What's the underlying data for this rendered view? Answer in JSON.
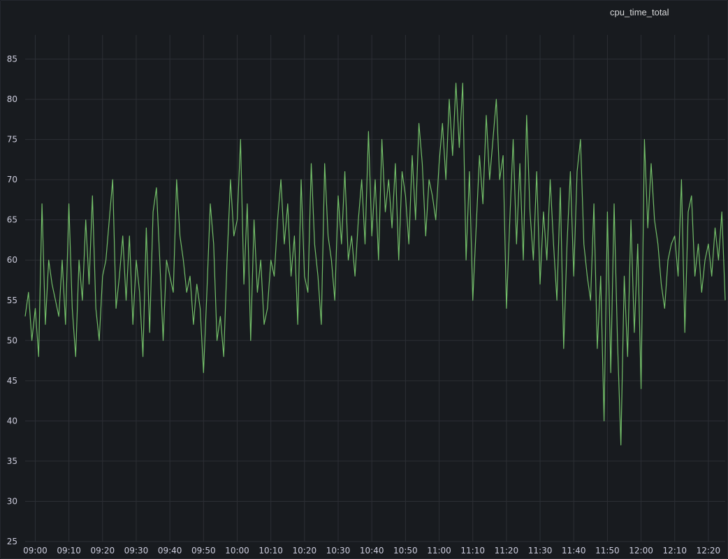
{
  "chart_data": {
    "type": "line",
    "title": "cpu_time_total",
    "xlabel": "",
    "ylabel": "",
    "y_ticks": [
      25,
      30,
      35,
      40,
      45,
      50,
      55,
      60,
      65,
      70,
      75,
      80,
      85
    ],
    "ylim": [
      25,
      88
    ],
    "x_ticks": [
      "09:00",
      "09:10",
      "09:20",
      "09:30",
      "09:40",
      "09:50",
      "10:00",
      "10:10",
      "10:20",
      "10:30",
      "10:40",
      "10:50",
      "11:00",
      "11:10",
      "11:20",
      "11:30",
      "11:40",
      "11:50",
      "12:00",
      "12:10",
      "12:20"
    ],
    "xlim": [
      "08:57",
      "12:25"
    ],
    "grid": true,
    "legend": "none",
    "series": [
      {
        "color": "#73bf69",
        "points": [
          [
            "08:57",
            53
          ],
          [
            "08:58",
            56
          ],
          [
            "08:59",
            50
          ],
          [
            "09:00",
            54
          ],
          [
            "09:01",
            48
          ],
          [
            "09:02",
            67
          ],
          [
            "09:03",
            52
          ],
          [
            "09:04",
            60
          ],
          [
            "09:05",
            57
          ],
          [
            "09:06",
            55
          ],
          [
            "09:07",
            53
          ],
          [
            "09:08",
            60
          ],
          [
            "09:09",
            52
          ],
          [
            "09:10",
            67
          ],
          [
            "09:11",
            54
          ],
          [
            "09:12",
            48
          ],
          [
            "09:13",
            60
          ],
          [
            "09:14",
            55
          ],
          [
            "09:15",
            65
          ],
          [
            "09:16",
            57
          ],
          [
            "09:17",
            68
          ],
          [
            "09:18",
            54
          ],
          [
            "09:19",
            50
          ],
          [
            "09:20",
            58
          ],
          [
            "09:21",
            60
          ],
          [
            "09:22",
            65
          ],
          [
            "09:23",
            70
          ],
          [
            "09:24",
            54
          ],
          [
            "09:25",
            58
          ],
          [
            "09:26",
            63
          ],
          [
            "09:27",
            55
          ],
          [
            "09:28",
            63
          ],
          [
            "09:29",
            52
          ],
          [
            "09:30",
            60
          ],
          [
            "09:31",
            56
          ],
          [
            "09:32",
            48
          ],
          [
            "09:33",
            64
          ],
          [
            "09:34",
            51
          ],
          [
            "09:35",
            66
          ],
          [
            "09:36",
            69
          ],
          [
            "09:37",
            60
          ],
          [
            "09:38",
            50
          ],
          [
            "09:39",
            60
          ],
          [
            "09:40",
            58
          ],
          [
            "09:41",
            56
          ],
          [
            "09:42",
            70
          ],
          [
            "09:43",
            63
          ],
          [
            "09:44",
            60
          ],
          [
            "09:45",
            56
          ],
          [
            "09:46",
            58
          ],
          [
            "09:47",
            52
          ],
          [
            "09:48",
            57
          ],
          [
            "09:49",
            54
          ],
          [
            "09:50",
            46
          ],
          [
            "09:51",
            56
          ],
          [
            "09:52",
            67
          ],
          [
            "09:53",
            62
          ],
          [
            "09:54",
            50
          ],
          [
            "09:55",
            53
          ],
          [
            "09:56",
            48
          ],
          [
            "09:57",
            60
          ],
          [
            "09:58",
            70
          ],
          [
            "09:59",
            63
          ],
          [
            "10:00",
            65
          ],
          [
            "10:01",
            75
          ],
          [
            "10:02",
            57
          ],
          [
            "10:03",
            67
          ],
          [
            "10:04",
            50
          ],
          [
            "10:05",
            65
          ],
          [
            "10:06",
            56
          ],
          [
            "10:07",
            60
          ],
          [
            "10:08",
            52
          ],
          [
            "10:09",
            54
          ],
          [
            "10:10",
            60
          ],
          [
            "10:11",
            58
          ],
          [
            "10:12",
            65
          ],
          [
            "10:13",
            70
          ],
          [
            "10:14",
            62
          ],
          [
            "10:15",
            67
          ],
          [
            "10:16",
            58
          ],
          [
            "10:17",
            63
          ],
          [
            "10:18",
            52
          ],
          [
            "10:19",
            70
          ],
          [
            "10:20",
            58
          ],
          [
            "10:21",
            56
          ],
          [
            "10:22",
            72
          ],
          [
            "10:23",
            62
          ],
          [
            "10:24",
            58
          ],
          [
            "10:25",
            52
          ],
          [
            "10:26",
            72
          ],
          [
            "10:27",
            63
          ],
          [
            "10:28",
            60
          ],
          [
            "10:29",
            55
          ],
          [
            "10:30",
            68
          ],
          [
            "10:31",
            62
          ],
          [
            "10:32",
            71
          ],
          [
            "10:33",
            60
          ],
          [
            "10:34",
            63
          ],
          [
            "10:35",
            58
          ],
          [
            "10:36",
            65
          ],
          [
            "10:37",
            70
          ],
          [
            "10:38",
            62
          ],
          [
            "10:39",
            76
          ],
          [
            "10:40",
            63
          ],
          [
            "10:41",
            70
          ],
          [
            "10:42",
            60
          ],
          [
            "10:43",
            75
          ],
          [
            "10:44",
            66
          ],
          [
            "10:45",
            70
          ],
          [
            "10:46",
            64
          ],
          [
            "10:47",
            72
          ],
          [
            "10:48",
            60
          ],
          [
            "10:49",
            71
          ],
          [
            "10:50",
            68
          ],
          [
            "10:51",
            62
          ],
          [
            "10:52",
            73
          ],
          [
            "10:53",
            65
          ],
          [
            "10:54",
            77
          ],
          [
            "10:55",
            72
          ],
          [
            "10:56",
            63
          ],
          [
            "10:57",
            70
          ],
          [
            "10:58",
            68
          ],
          [
            "10:59",
            65
          ],
          [
            "11:00",
            72
          ],
          [
            "11:01",
            77
          ],
          [
            "11:02",
            70
          ],
          [
            "11:03",
            80
          ],
          [
            "11:04",
            73
          ],
          [
            "11:05",
            82
          ],
          [
            "11:06",
            74
          ],
          [
            "11:07",
            82
          ],
          [
            "11:08",
            60
          ],
          [
            "11:09",
            71
          ],
          [
            "11:10",
            55
          ],
          [
            "11:11",
            64
          ],
          [
            "11:12",
            73
          ],
          [
            "11:13",
            67
          ],
          [
            "11:14",
            78
          ],
          [
            "11:15",
            70
          ],
          [
            "11:16",
            75
          ],
          [
            "11:17",
            80
          ],
          [
            "11:18",
            70
          ],
          [
            "11:19",
            73
          ],
          [
            "11:20",
            54
          ],
          [
            "11:21",
            65
          ],
          [
            "11:22",
            75
          ],
          [
            "11:23",
            62
          ],
          [
            "11:24",
            72
          ],
          [
            "11:25",
            60
          ],
          [
            "11:26",
            78
          ],
          [
            "11:27",
            66
          ],
          [
            "11:28",
            60
          ],
          [
            "11:29",
            71
          ],
          [
            "11:30",
            57
          ],
          [
            "11:31",
            66
          ],
          [
            "11:32",
            60
          ],
          [
            "11:33",
            70
          ],
          [
            "11:34",
            62
          ],
          [
            "11:35",
            55
          ],
          [
            "11:36",
            69
          ],
          [
            "11:37",
            49
          ],
          [
            "11:38",
            62
          ],
          [
            "11:39",
            71
          ],
          [
            "11:40",
            58
          ],
          [
            "11:41",
            71
          ],
          [
            "11:42",
            75
          ],
          [
            "11:43",
            62
          ],
          [
            "11:44",
            58
          ],
          [
            "11:45",
            55
          ],
          [
            "11:46",
            67
          ],
          [
            "11:47",
            49
          ],
          [
            "11:48",
            58
          ],
          [
            "11:49",
            40
          ],
          [
            "11:50",
            66
          ],
          [
            "11:51",
            46
          ],
          [
            "11:52",
            67
          ],
          [
            "11:53",
            50
          ],
          [
            "11:54",
            37
          ],
          [
            "11:55",
            58
          ],
          [
            "11:56",
            48
          ],
          [
            "11:57",
            65
          ],
          [
            "11:58",
            51
          ],
          [
            "11:59",
            62
          ],
          [
            "12:00",
            44
          ],
          [
            "12:01",
            75
          ],
          [
            "12:02",
            64
          ],
          [
            "12:03",
            72
          ],
          [
            "12:04",
            65
          ],
          [
            "12:05",
            62
          ],
          [
            "12:06",
            57
          ],
          [
            "12:07",
            54
          ],
          [
            "12:08",
            60
          ],
          [
            "12:09",
            62
          ],
          [
            "12:10",
            63
          ],
          [
            "12:11",
            58
          ],
          [
            "12:12",
            70
          ],
          [
            "12:13",
            51
          ],
          [
            "12:14",
            66
          ],
          [
            "12:15",
            68
          ],
          [
            "12:16",
            58
          ],
          [
            "12:17",
            62
          ],
          [
            "12:18",
            56
          ],
          [
            "12:19",
            60
          ],
          [
            "12:20",
            62
          ],
          [
            "12:21",
            58
          ],
          [
            "12:22",
            64
          ],
          [
            "12:23",
            60
          ],
          [
            "12:24",
            66
          ],
          [
            "12:25",
            55
          ]
        ]
      }
    ]
  }
}
